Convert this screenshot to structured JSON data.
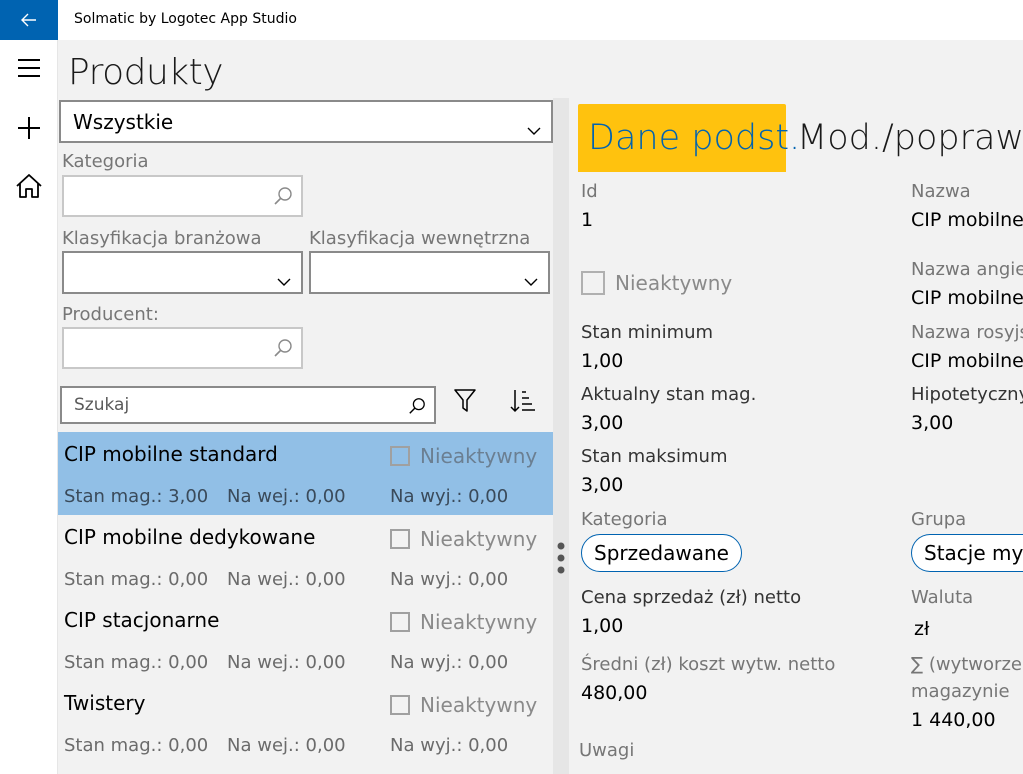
{
  "app": {
    "title": "Solmatic by Logotec App Studio"
  },
  "page": {
    "title": "Produkty"
  },
  "filters": {
    "type_selected": "Wszystkie",
    "kategoria_label": "Kategoria",
    "klasyfikacja_branzowa_label": "Klasyfikacja branżowa",
    "klasyfikacja_wewnetrzna_label": "Klasyfikacja wewnętrzna",
    "producent_label": "Producent:",
    "search_placeholder": "Szukaj"
  },
  "products": [
    {
      "name": "CIP mobilne standard",
      "inactive_label": "Nieaktywny",
      "stan": "Stan mag.: 3,00",
      "na_wej": "Na wej.: 0,00",
      "na_wyj": "Na wyj.: 0,00",
      "selected": true
    },
    {
      "name": "CIP mobilne dedykowane",
      "inactive_label": "Nieaktywny",
      "stan": "Stan mag.: 0,00",
      "na_wej": "Na wej.: 0,00",
      "na_wyj": "Na wyj.: 0,00",
      "selected": false
    },
    {
      "name": "CIP stacjonarne",
      "inactive_label": "Nieaktywny",
      "stan": "Stan mag.: 0,00",
      "na_wej": "Na wej.: 0,00",
      "na_wyj": "Na wyj.: 0,00",
      "selected": false
    },
    {
      "name": "Twistery",
      "inactive_label": "Nieaktywny",
      "stan": "Stan mag.: 0,00",
      "na_wej": "Na wej.: 0,00",
      "na_wyj": "Na wyj.: 0,00",
      "selected": false
    }
  ],
  "tabs": {
    "active": "Dane podst.",
    "second": "Mod./poprawk"
  },
  "details": {
    "id_label": "Id",
    "id_value": "1",
    "nazwa_label": "Nazwa",
    "nazwa_value": "CIP mobilne",
    "nieaktywny_label": "Nieaktywny",
    "nazwa_ang_label": "Nazwa angiel",
    "nazwa_ang_value": "CIP mobilne",
    "stan_min_label": "Stan minimum",
    "stan_min_value": "1,00",
    "nazwa_ros_label": "Nazwa rosyjsk",
    "nazwa_ros_value": "CIP mobilne",
    "aktualny_label": "Aktualny stan mag.",
    "aktualny_value": "3,00",
    "hipotetyczny_label": "Hipotetyczny",
    "hipotetyczny_value": "3,00",
    "stan_max_label": "Stan maksimum",
    "stan_max_value": "3,00",
    "kategoria_label": "Kategoria",
    "kategoria_value": "Sprzedawane",
    "grupa_label": "Grupa",
    "grupa_value": "Stacje myja",
    "cena_label": "Cena sprzedaż (zł) netto",
    "cena_value": "1,00",
    "waluta_label": "Waluta",
    "waluta_value": "zł",
    "sredni_label": "Średni (zł) koszt wytw. netto",
    "sredni_value": "480,00",
    "suma_label_1": "∑ (wytworzen",
    "suma_label_2": "magazynie",
    "suma_value": "1 440,00",
    "uwagi_label": "Uwagi"
  },
  "colors": {
    "accent": "#0063b1",
    "tab_active_bg": "#ffc20e",
    "selected_row": "#91bfe6",
    "panel_bg": "#f2f2f2"
  }
}
